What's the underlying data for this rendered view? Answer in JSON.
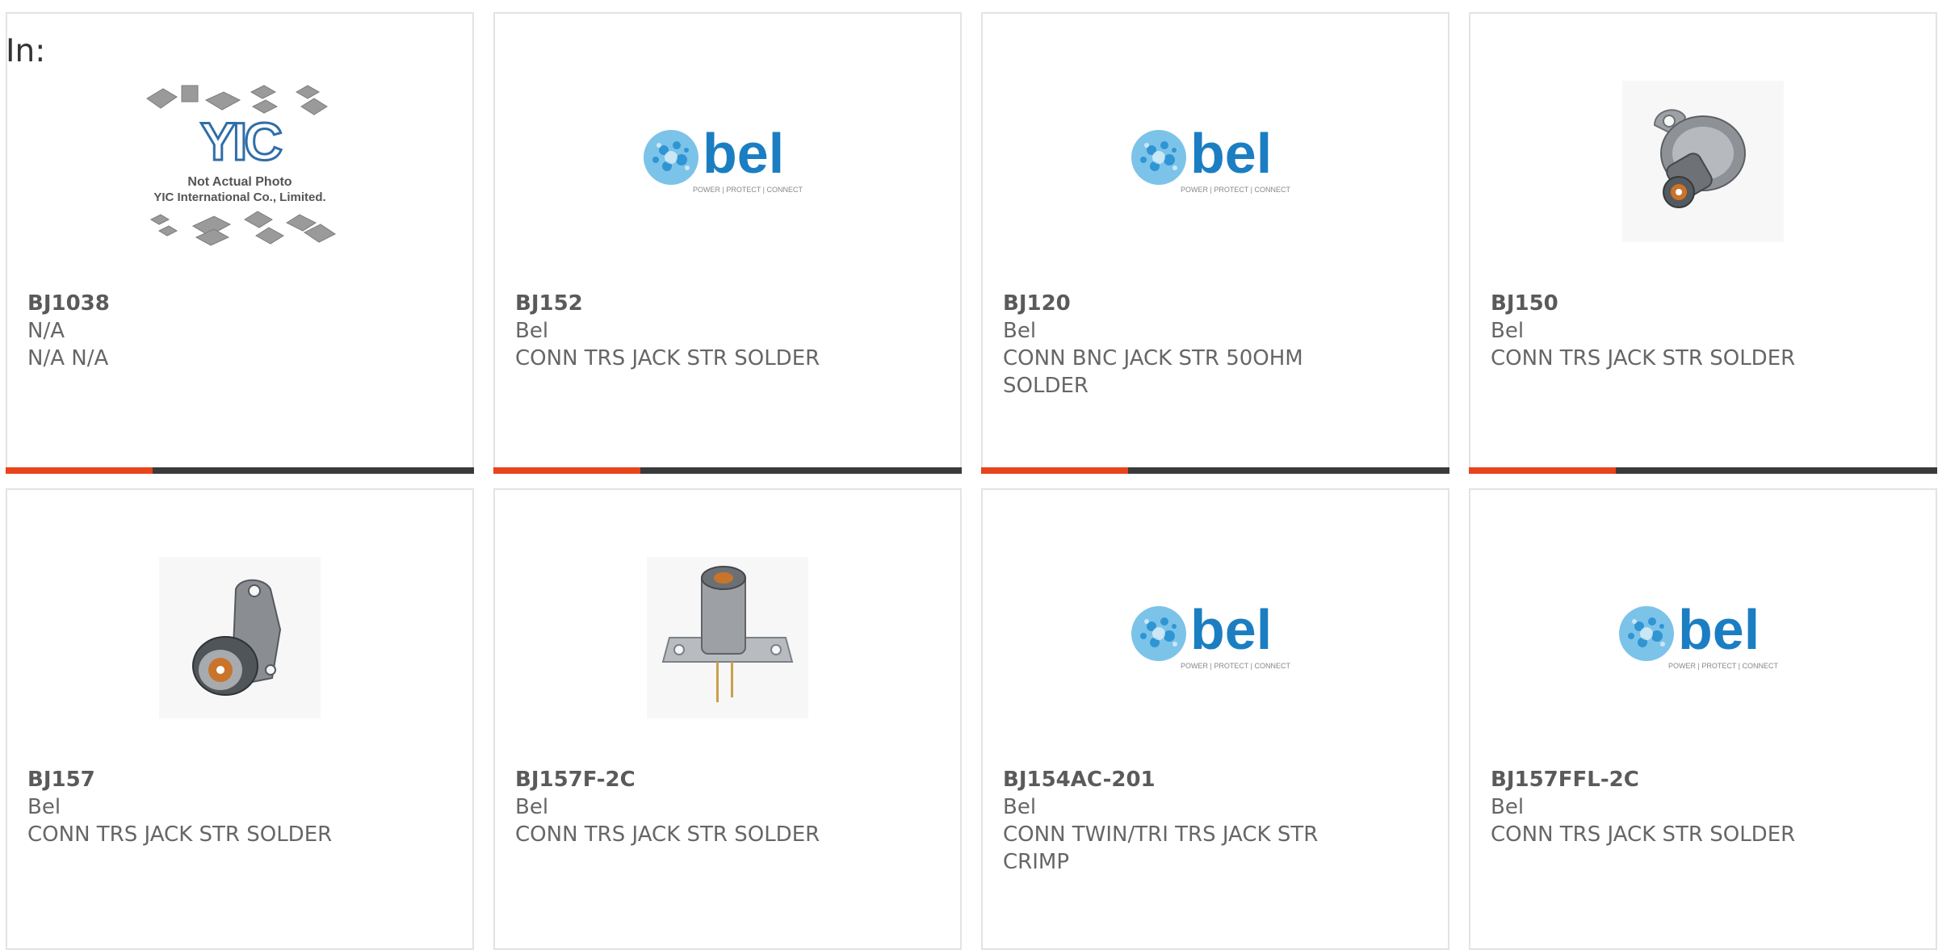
{
  "filter_label": "In:",
  "products": [
    {
      "part": "BJ1038",
      "manufacturer": "N/A",
      "description": "N/A N/A",
      "image": "placeholder-photo"
    },
    {
      "part": "BJ152",
      "manufacturer": "Bel",
      "description": "CONN TRS JACK STR SOLDER",
      "image": "bel-logo"
    },
    {
      "part": "BJ120",
      "manufacturer": "Bel",
      "description": "CONN BNC JACK STR 50OHM SOLDER",
      "image": "bel-logo"
    },
    {
      "part": "BJ150",
      "manufacturer": "Bel",
      "description": "CONN TRS JACK STR SOLDER",
      "image": "connector-photo"
    },
    {
      "part": "BJ157",
      "manufacturer": "Bel",
      "description": "CONN TRS JACK STR SOLDER",
      "image": "connector-photo"
    },
    {
      "part": "BJ157F-2C",
      "manufacturer": "Bel",
      "description": "CONN TRS JACK STR SOLDER",
      "image": "connector-photo"
    },
    {
      "part": "BJ154AC-201",
      "manufacturer": "Bel",
      "description": "CONN TWIN/TRI TRS JACK STR CRIMP",
      "image": "bel-logo"
    },
    {
      "part": "BJ157FFL-2C",
      "manufacturer": "Bel",
      "description": "CONN TRS JACK STR SOLDER",
      "image": "bel-logo"
    }
  ],
  "placeholder_image": {
    "logo_text": "YIC",
    "caption_line1": "Not Actual Photo",
    "caption_line2": "YIC International Co., Limited."
  },
  "bel_logo": {
    "wordmark": "bel",
    "tagline": "POWER | PROTECT | CONNECT"
  },
  "colors": {
    "accent": "#e8431b",
    "bar": "#3a3a3a",
    "bel_blue": "#1b7ec2",
    "bel_light": "#4aa8dc",
    "text": "#666666"
  }
}
